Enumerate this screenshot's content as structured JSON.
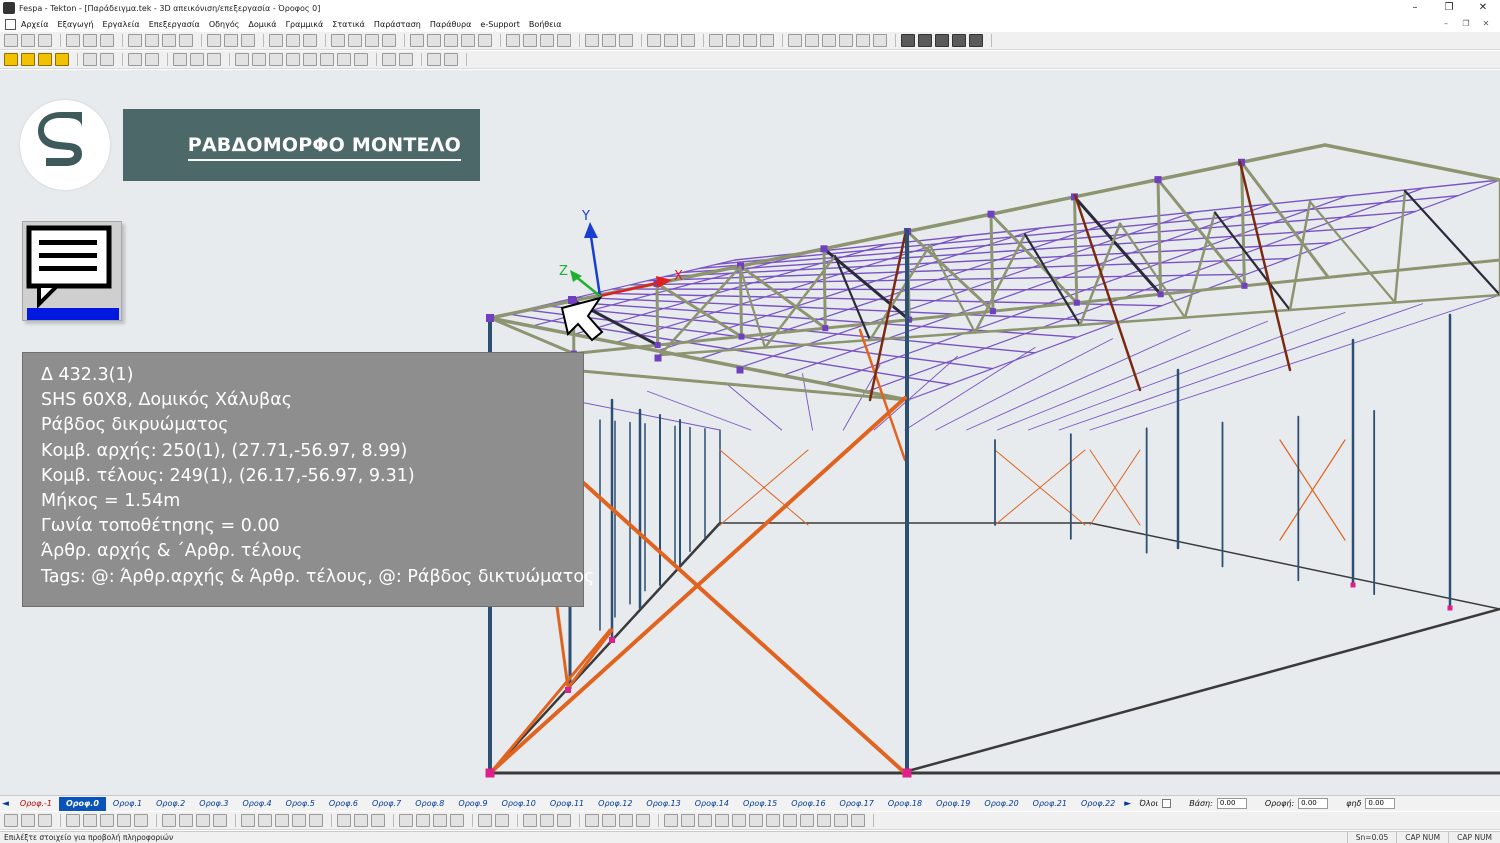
{
  "window": {
    "title": "Fespa - Tekton - [Παράδειγμα.tek - 3D απεικόνιση/επεξεργασία - Όροφος 0]",
    "minimize": "–",
    "restore": "❐",
    "close": "✕"
  },
  "menu": {
    "items": [
      "Αρχεία",
      "Εξαγωγή",
      "Εργαλεία",
      "Επεξεργασία",
      "Οδηγός",
      "Δομικά",
      "Γραμμικά",
      "Στατικά",
      "Παράσταση",
      "Παράθυρα",
      "e-Support",
      "Βοήθεια"
    ],
    "mdi_minimize": "–",
    "mdi_restore": "❐",
    "mdi_close": "✕"
  },
  "banner": {
    "title": "ΡΑΒΔΟΜΟΡΦΟ ΜΟΝΤΕΛΟ"
  },
  "logo": {
    "icon": "fespa-s-logo-icon",
    "color": "#3f5a5a"
  },
  "info_panel": {
    "lines": [
      "Δ 432.3(1)",
      "SHS 60X8, Δομικός Χάλυβας",
      "Ράβδος δικρυώματος",
      "Κομβ. αρχής: 250(1), (27.71,-56.97, 8.99)",
      "Κομβ. τέλους: 249(1), (26.17,-56.97, 9.31)",
      "Μήκος = 1.54m",
      "Γωνία τοποθέτησης = 0.00",
      "Άρθρ. αρχής & ΄Αρθρ. τέλους",
      "Tags: @: Άρθρ.αρχής & Άρθρ. τέλους, @: Ράβδος δικτυώματος"
    ]
  },
  "axes": {
    "x": "X",
    "y": "Y",
    "z": "Z"
  },
  "colors": {
    "truss": "#8c9470",
    "purlin": "#7a52c4",
    "column": "#2d4f72",
    "brace": "#e06420",
    "node": "#7040c0",
    "base_node": "#e0208a",
    "viewport_bg": "#e7ebee",
    "banner_bg": "#4d6868"
  },
  "floor_tabs": {
    "nav_left": "◄",
    "nav_right": "►",
    "items": [
      "Οροφ.-1",
      "Οροφ.0",
      "Οροφ.1",
      "Οροφ.2",
      "Οροφ.3",
      "Οροφ.4",
      "Οροφ.5",
      "Οροφ.6",
      "Οροφ.7",
      "Οροφ.8",
      "Οροφ.9",
      "Οροφ.10",
      "Οροφ.11",
      "Οροφ.12",
      "Οροφ.13",
      "Οροφ.14",
      "Οροφ.15",
      "Οροφ.16",
      "Οροφ.17",
      "Οροφ.18",
      "Οροφ.19",
      "Οροφ.20",
      "Οροφ.21",
      "Οροφ.22"
    ],
    "active": "Οροφ.0",
    "all_label": "Όλοι",
    "base_label": "Βάση:",
    "base_value": "0.00",
    "roof_label": "Οροφή:",
    "roof_value": "0.00",
    "step_label": "φηδ",
    "step_value": "0.00"
  },
  "status": {
    "message": "Επιλέξτε στοιχείο για προβολή πληροφοριών",
    "snap": "Sn=0.05",
    "caps1": "CAP NUM",
    "caps2": "CAP NUM"
  }
}
